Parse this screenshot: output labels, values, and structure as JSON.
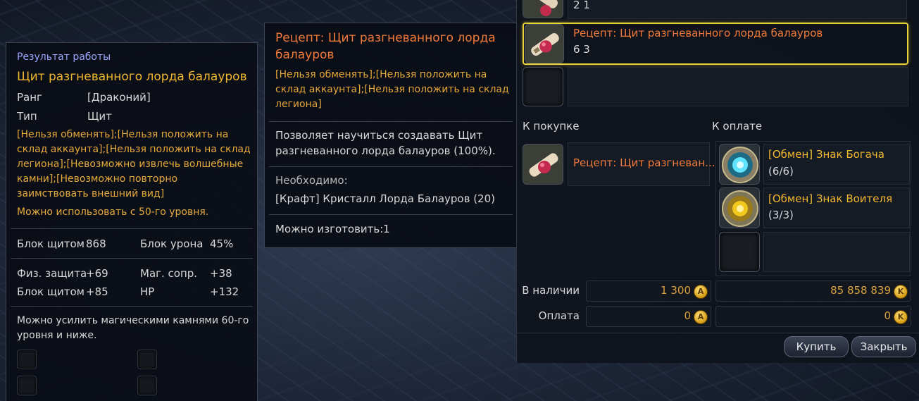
{
  "item_tooltip": {
    "header": "Результат работы",
    "name": "Щит разгневанного лорда балауров",
    "rank_label": "Ранг",
    "rank_value": "[Драконий]",
    "type_label": "Тип",
    "type_value": "Щит",
    "restrictions": [
      "[Нельзя обменять];[Нельзя положить на",
      "склад аккаунта];[Нельзя положить на склад",
      "легиона];[Невозможно извлечь волшебные",
      "камни];[Невозможно повторно",
      "заимствовать внешний вид]"
    ],
    "level_req": "Можно использовать с 50-го уровня.",
    "stats1": [
      {
        "label": "Блок щитом",
        "value": "868"
      },
      {
        "label": "Блок урона",
        "value": "45%"
      }
    ],
    "stats2": [
      {
        "label": "Физ. защита",
        "value": "+69"
      },
      {
        "label": "Маг. сопр.",
        "value": "+38"
      },
      {
        "label": "Блок щитом",
        "value": "+85"
      },
      {
        "label": "HP",
        "value": "+132"
      }
    ],
    "enhance_text": [
      "Можно усилить магическими камнями 60-го",
      "уровня и ниже."
    ]
  },
  "recipe_tooltip": {
    "title": [
      "Рецепт: Щит разгневанного лорда",
      "балауров"
    ],
    "restrictions": [
      "[Нельзя обменять];[Нельзя положить на",
      "склад аккаунта];[Нельзя положить на склад",
      "легиона]"
    ],
    "description": [
      "Позволяет научиться создавать Щит",
      "разгневанного лорда балауров (100%)."
    ],
    "required_label": "Необходимо:",
    "required_item": "[Крафт] Кристалл Лорда Балауров (20)",
    "craftable_label": "Можно изготовить:",
    "craftable_value": "1"
  },
  "shop": {
    "top_row_numbers": "2 1",
    "selected_row": {
      "name": "Рецепт: Щит разгневанного лорда балауров",
      "numbers": "6 3"
    },
    "buy_header": "К покупке",
    "pay_header": "К оплате",
    "buy_item": "Рецепт: Щит разгневан...",
    "pay_items": [
      {
        "name": "[Обмен] Знак Богача",
        "count": "(6/6)"
      },
      {
        "name": "[Обмен] Знак Воителя",
        "count": "(3/3)"
      }
    ],
    "available_label": "В наличии",
    "available_ap": "1 300",
    "available_kinah": "85 858 839",
    "payment_label": "Оплата",
    "payment_ap": "0",
    "payment_kinah": "0",
    "coin_ap_symbol": "A",
    "coin_kinah_symbol": "K",
    "buy_button": "Купить",
    "close_button": "Закрыть"
  },
  "colors": {
    "item_name": "#f2b830",
    "recipe_title": "#f07a3a",
    "restriction": "#e6a93c",
    "header": "#9aa3ff",
    "selection": "#e8d23a"
  }
}
